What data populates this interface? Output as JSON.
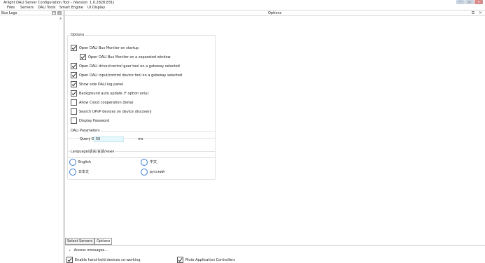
{
  "window": {
    "title": "Arlight DALI Server Configuration Tool - (Version: 1.0.2828.831)",
    "buttons": {
      "minimize": "—",
      "maximize": "▭",
      "close": "✕"
    }
  },
  "menu": {
    "items": [
      "Files",
      "Servers",
      "DALI Tools",
      "Smart Engine",
      "UI Display"
    ]
  },
  "left_panel": {
    "title": "Bus Logs",
    "btn_dock": "▣",
    "btn_close": "✕"
  },
  "options_panel": {
    "title": "Options",
    "header_icons": "⧉ ✕",
    "group_options": {
      "title": "Options",
      "items": [
        {
          "label": "Open DALI Bus Monitor on startup",
          "checked": true
        },
        {
          "label": "Open DALI Bus Monitor on a separated window",
          "checked": true
        },
        {
          "label": "Open DALI driver/control gear tool on a gateway selected",
          "checked": true
        },
        {
          "label": "Open DALI input/control device tool on a gateway selected",
          "checked": true
        },
        {
          "label": "Show side DALI log panel",
          "checked": true
        },
        {
          "label": "Background auto update (* option only)",
          "checked": true
        },
        {
          "label": "Allow Cloud cooperation (beta)",
          "checked": false
        },
        {
          "label": "Search UPnP devices on device discovery",
          "checked": false
        },
        {
          "label": "Display Password",
          "checked": false
        }
      ]
    },
    "group_dali": {
      "title": "DALI Parameters",
      "query_delay_label": "Query Delay:",
      "query_delay_value": "50",
      "query_delay_unit": "ms"
    },
    "group_language": {
      "title": "Language/語言/言語/язык",
      "options": [
        "English",
        "中文",
        "日本文",
        "русский"
      ]
    }
  },
  "bottom": {
    "tabs": [
      "Select Servers",
      "Options"
    ],
    "access_label": "Access messages...",
    "checks": [
      {
        "label": "Enable hand-held devices co-working",
        "checked": true
      },
      {
        "label": "Mute Application Controllers",
        "checked": true
      }
    ]
  }
}
